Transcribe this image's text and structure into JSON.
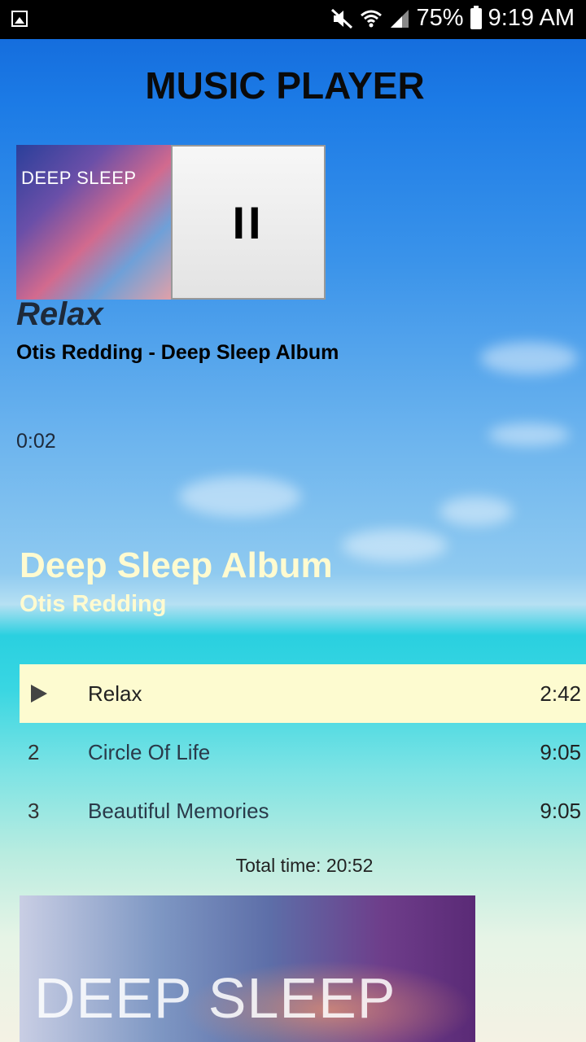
{
  "status_bar": {
    "battery": "75%",
    "time": "9:19 AM"
  },
  "app": {
    "title": "MUSIC PLAYER"
  },
  "now_playing": {
    "album_art_text": "DEEP SLEEP",
    "play_state": "paused-control",
    "track_title": "Relax",
    "artist_album": "Otis Redding - Deep Sleep Album",
    "elapsed": "0:02"
  },
  "album": {
    "name": "Deep Sleep Album",
    "artist": "Otis Redding",
    "tracks": [
      {
        "number": "",
        "name": "Relax",
        "duration": "2:42",
        "active": true
      },
      {
        "number": "2",
        "name": "Circle Of Life",
        "duration": "9:05",
        "active": false
      },
      {
        "number": "3",
        "name": "Beautiful Memories",
        "duration": "9:05",
        "active": false
      }
    ],
    "total_time": "Total time: 20:52",
    "cover_text": "DEEP SLEEP"
  },
  "colors": {
    "accent": "#fffbd0",
    "active_row": "#fdfbd0"
  }
}
